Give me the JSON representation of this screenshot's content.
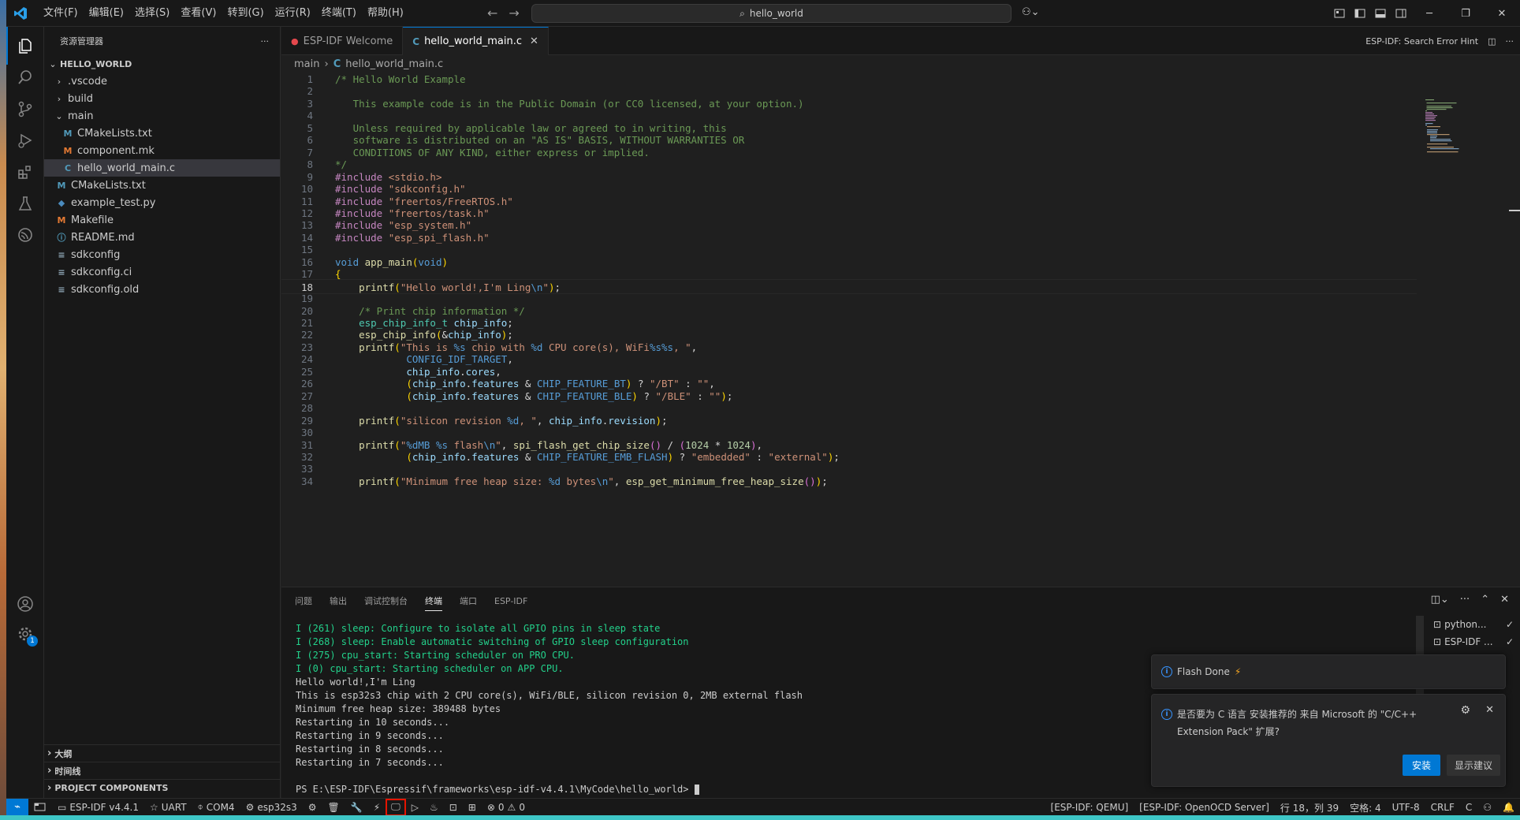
{
  "titlebar": {
    "menus": [
      "文件(F)",
      "编辑(E)",
      "选择(S)",
      "查看(V)",
      "转到(G)",
      "运行(R)",
      "终端(T)",
      "帮助(H)"
    ],
    "search_text": "hello_world"
  },
  "sidebar": {
    "title": "资源管理器",
    "root": "HELLO_WORLD",
    "items": [
      {
        "label": ".vscode",
        "kind": "folder"
      },
      {
        "label": "build",
        "kind": "folder"
      },
      {
        "label": "main",
        "kind": "folder-open"
      },
      {
        "label": "CMakeLists.txt",
        "kind": "M-blue"
      },
      {
        "label": "component.mk",
        "kind": "M"
      },
      {
        "label": "hello_world_main.c",
        "kind": "C"
      },
      {
        "label": "CMakeLists.txt",
        "kind": "M-blue"
      },
      {
        "label": "example_test.py",
        "kind": "py"
      },
      {
        "label": "Makefile",
        "kind": "M"
      },
      {
        "label": "README.md",
        "kind": "info"
      },
      {
        "label": "sdkconfig",
        "kind": "lines"
      },
      {
        "label": "sdkconfig.ci",
        "kind": "lines"
      },
      {
        "label": "sdkconfig.old",
        "kind": "lines"
      }
    ],
    "sections": [
      "大纲",
      "时间线",
      "PROJECT COMPONENTS"
    ]
  },
  "tabs": [
    {
      "label": "ESP-IDF Welcome",
      "active": false
    },
    {
      "label": "hello_world_main.c",
      "active": true
    }
  ],
  "tab_right_label": "ESP-IDF: Search Error Hint",
  "breadcrumb": [
    "main",
    "hello_world_main.c"
  ],
  "editor": {
    "current_line": 18,
    "lines": [
      "/* Hello World Example",
      "",
      "   This example code is in the Public Domain (or CC0 licensed, at your option.)",
      "",
      "   Unless required by applicable law or agreed to in writing, this",
      "   software is distributed on an \"AS IS\" BASIS, WITHOUT WARRANTIES OR",
      "   CONDITIONS OF ANY KIND, either express or implied.",
      "*/",
      "#include <stdio.h>",
      "#include \"sdkconfig.h\"",
      "#include \"freertos/FreeRTOS.h\"",
      "#include \"freertos/task.h\"",
      "#include \"esp_system.h\"",
      "#include \"esp_spi_flash.h\"",
      "",
      "void app_main(void)",
      "{",
      "    printf(\"Hello world!,I'm Ling\\n\");",
      "",
      "    /* Print chip information */",
      "    esp_chip_info_t chip_info;",
      "    esp_chip_info(&chip_info);",
      "    printf(\"This is %s chip with %d CPU core(s), WiFi%s%s, \",",
      "            CONFIG_IDF_TARGET,",
      "            chip_info.cores,",
      "            (chip_info.features & CHIP_FEATURE_BT) ? \"/BT\" : \"\",",
      "            (chip_info.features & CHIP_FEATURE_BLE) ? \"/BLE\" : \"\");",
      "",
      "    printf(\"silicon revision %d, \", chip_info.revision);",
      "",
      "    printf(\"%dMB %s flash\\n\", spi_flash_get_chip_size() / (1024 * 1024),",
      "            (chip_info.features & CHIP_FEATURE_EMB_FLASH) ? \"embedded\" : \"external\");",
      "",
      "    printf(\"Minimum free heap size: %d bytes\\n\", esp_get_minimum_free_heap_size());"
    ]
  },
  "panel": {
    "tabs": [
      "问题",
      "输出",
      "调试控制台",
      "终端",
      "端口",
      "ESP-IDF"
    ],
    "active_tab": "终端",
    "terminal_lines": [
      {
        "text": "I (261) sleep: Configure to isolate all GPIO pins in sleep state",
        "green": true
      },
      {
        "text": "I (268) sleep: Enable automatic switching of GPIO sleep configuration",
        "green": true
      },
      {
        "text": "I (275) cpu_start: Starting scheduler on PRO CPU.",
        "green": true
      },
      {
        "text": "I (0) cpu_start: Starting scheduler on APP CPU.",
        "green": true
      },
      {
        "text": "Hello world!,I'm Ling",
        "green": false
      },
      {
        "text": "This is esp32s3 chip with 2 CPU core(s), WiFi/BLE, silicon revision 0, 2MB external flash",
        "green": false
      },
      {
        "text": "Minimum free heap size: 389488 bytes",
        "green": false
      },
      {
        "text": "Restarting in 10 seconds...",
        "green": false
      },
      {
        "text": "Restarting in 9 seconds...",
        "green": false
      },
      {
        "text": "Restarting in 8 seconds...",
        "green": false
      },
      {
        "text": "Restarting in 7 seconds...",
        "green": false
      },
      {
        "text": "",
        "green": false
      },
      {
        "text": "PS E:\\ESP-IDF\\Espressif\\frameworks\\esp-idf-v4.4.1\\MyCode\\hello_world> ",
        "green": false
      }
    ],
    "terminals": [
      "python...",
      "ESP-IDF ..."
    ]
  },
  "notifications": {
    "flash": {
      "text": "Flash Done",
      "icon": "lightning-icon"
    },
    "ext": {
      "line1": "是否要为 C 语言 安装推荐的 来自 Microsoft 的 \"C/C++",
      "line2": "Extension Pack\" 扩展?",
      "install": "安装",
      "show": "显示建议"
    }
  },
  "statusbar": {
    "idf_version": "ESP-IDF v4.4.1",
    "uart": "UART",
    "port": "COM4",
    "target": "esp32s3",
    "problems": "0",
    "warnings": "0",
    "qemu": "[ESP-IDF: QEMU]",
    "openocd": "[ESP-IDF: OpenOCD Server]",
    "position": "行 18，列 39",
    "spaces": "空格: 4",
    "encoding": "UTF-8",
    "eol": "CRLF",
    "language": "C"
  },
  "colors": {
    "accent": "#0078d4",
    "highlight_box": "#e51400"
  }
}
